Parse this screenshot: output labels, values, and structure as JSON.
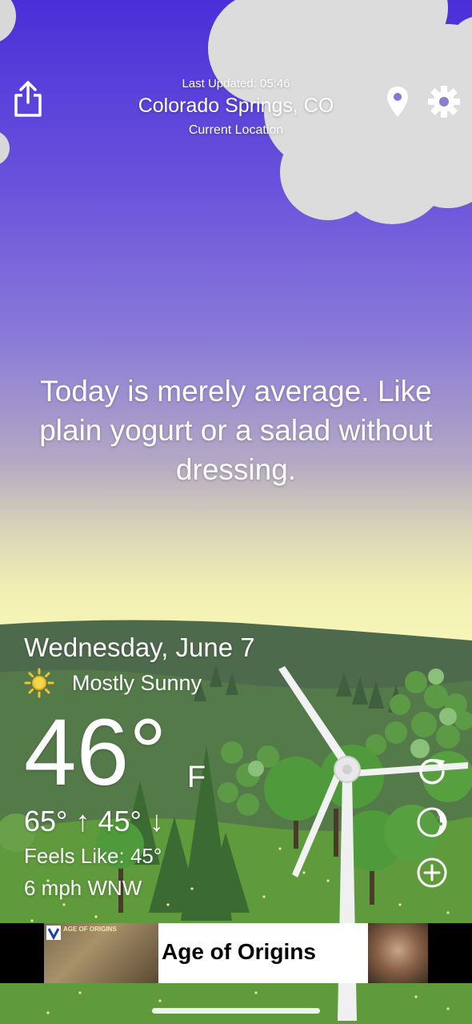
{
  "header": {
    "last_updated": "Last Updated: 05:46",
    "city": "Colorado Springs, CO",
    "subtitle": "Current Location",
    "share_icon": "share-icon",
    "location_icon": "map-pin-icon",
    "settings_icon": "gear-icon"
  },
  "quote": "Today is merely average. Like plain yogurt or a salad without dressing.",
  "weather": {
    "date": "Wednesday, June 7",
    "condition_icon": "sun-icon",
    "condition": "Mostly Sunny",
    "temperature": "46°",
    "unit": "F",
    "hi_lo": "65° ↑  45° ↓",
    "feels_like": "Feels Like: 45°",
    "wind": "6 mph WNW"
  },
  "side_actions": {
    "refresh_icon": "refresh-icon",
    "theme_icon": "theme-toggle-icon",
    "add_icon": "add-icon"
  },
  "ad": {
    "thumb_label": "AGE OF ORIGINS",
    "title": "Age of Origins"
  },
  "colors": {
    "sky_top": "#4a2fd8",
    "sky_horizon": "#f6f5b8",
    "hills_far": "#4e6a4c",
    "grass": "#5f9a3c",
    "ad_bar": "#000000"
  }
}
